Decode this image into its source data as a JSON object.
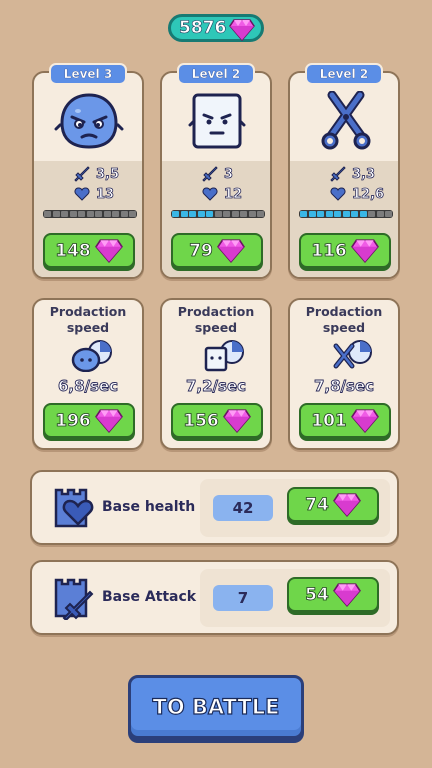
{
  "currency": {
    "amount": "5876",
    "icon": "gem-icon"
  },
  "units": [
    {
      "name": "blob",
      "level": "Level 3",
      "attack": "3,5",
      "health": "13",
      "progress": 0.0,
      "price": "148"
    },
    {
      "name": "box",
      "level": "Level 2",
      "attack": "3",
      "health": "12",
      "progress": 0.4,
      "price": "79"
    },
    {
      "name": "scissors",
      "level": "Level 2",
      "attack": "3,3",
      "health": "12,6",
      "progress": 0.73,
      "price": "116"
    }
  ],
  "production": [
    {
      "title": "Prodaction speed",
      "rate": "6,8/sec",
      "price": "196"
    },
    {
      "title": "Prodaction speed",
      "rate": "7,2/sec",
      "price": "156"
    },
    {
      "title": "Prodaction speed",
      "rate": "7,8/sec",
      "price": "101"
    }
  ],
  "base_health": {
    "label": "Base health",
    "value": "42",
    "price": "74"
  },
  "base_attack": {
    "label": "Base Attack",
    "value": "7",
    "price": "54"
  },
  "battle_button": "TO BATTLE",
  "colors": {
    "gem": "#e64ad9",
    "accent_blue": "#5b8ee6",
    "button_green": "#6fd64a"
  }
}
